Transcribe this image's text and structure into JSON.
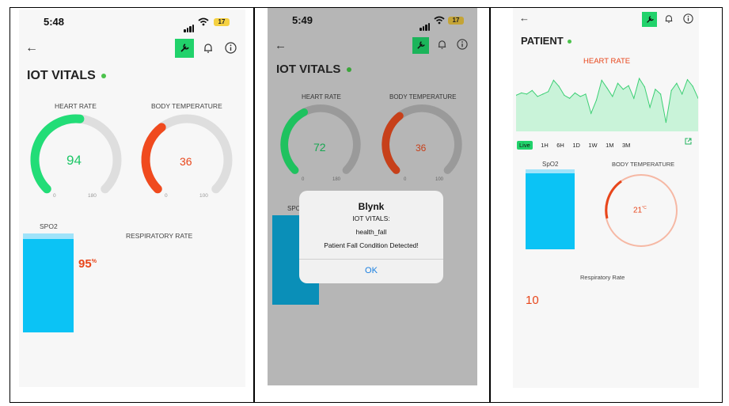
{
  "screen1": {
    "time": "5:48",
    "battery": "17",
    "title": "IOT VITALS",
    "heart_rate": {
      "label": "HEART RATE",
      "value": "94",
      "min": "0",
      "max": "180",
      "fraction": 0.52,
      "color": "#22dd77"
    },
    "body_temp": {
      "label": "BODY TEMPERATURE",
      "value": "36",
      "min": "0",
      "max": "100",
      "fraction": 0.36,
      "color": "#f04a1e"
    },
    "spo2": {
      "label": "SPO2",
      "value": "95",
      "unit": "%"
    },
    "respiratory": {
      "label": "RESPIRATORY RATE"
    }
  },
  "screen2": {
    "time": "5:49",
    "battery": "17",
    "title": "IOT VITALS",
    "heart_rate": {
      "label": "HEART RATE",
      "value": "72",
      "min": "0",
      "max": "180",
      "fraction": 0.4
    },
    "body_temp": {
      "label": "BODY TEMPERATURE",
      "value": "36",
      "min": "0",
      "max": "100",
      "fraction": 0.36
    },
    "spo2_label": "SPO",
    "alert": {
      "app": "Blynk",
      "source": "IOT VITALS:",
      "event": "health_fall",
      "message": "Patient Fall Condition Detected!",
      "ok": "OK"
    }
  },
  "screen3": {
    "title": "PATIENT",
    "chart_title": "HEART RATE",
    "ranges": [
      "Live",
      "1H",
      "6H",
      "1D",
      "1W",
      "1M",
      "3M"
    ],
    "spo2_label": "SpO2",
    "body_temp": {
      "label": "BODY TEMPERATURE",
      "value": "21",
      "unit": "°C"
    },
    "respiratory": {
      "label": "Respiratory Rate",
      "value": "10"
    },
    "chart_data": {
      "type": "area",
      "title": "HEART RATE",
      "x": [
        0,
        1,
        2,
        3,
        4,
        5,
        6,
        7,
        8,
        9,
        10,
        11,
        12,
        13,
        14,
        15,
        16,
        17,
        18,
        19,
        20,
        21,
        22,
        23,
        24,
        25,
        26,
        27,
        28,
        29,
        30,
        31,
        32,
        33,
        34
      ],
      "values": [
        60,
        64,
        62,
        68,
        58,
        62,
        66,
        85,
        75,
        60,
        55,
        64,
        58,
        62,
        30,
        52,
        85,
        72,
        58,
        80,
        70,
        76,
        55,
        88,
        74,
        40,
        70,
        62,
        15,
        68,
        80,
        62,
        86,
        75,
        55
      ],
      "ylim": [
        0,
        100
      ]
    }
  },
  "colors": {
    "accent_green": "#21d26b",
    "heart_green": "#22dd77",
    "temp_red": "#f04a1e",
    "spo2_blue": "#0bc3f5",
    "alert_blue": "#1a7fe0"
  }
}
